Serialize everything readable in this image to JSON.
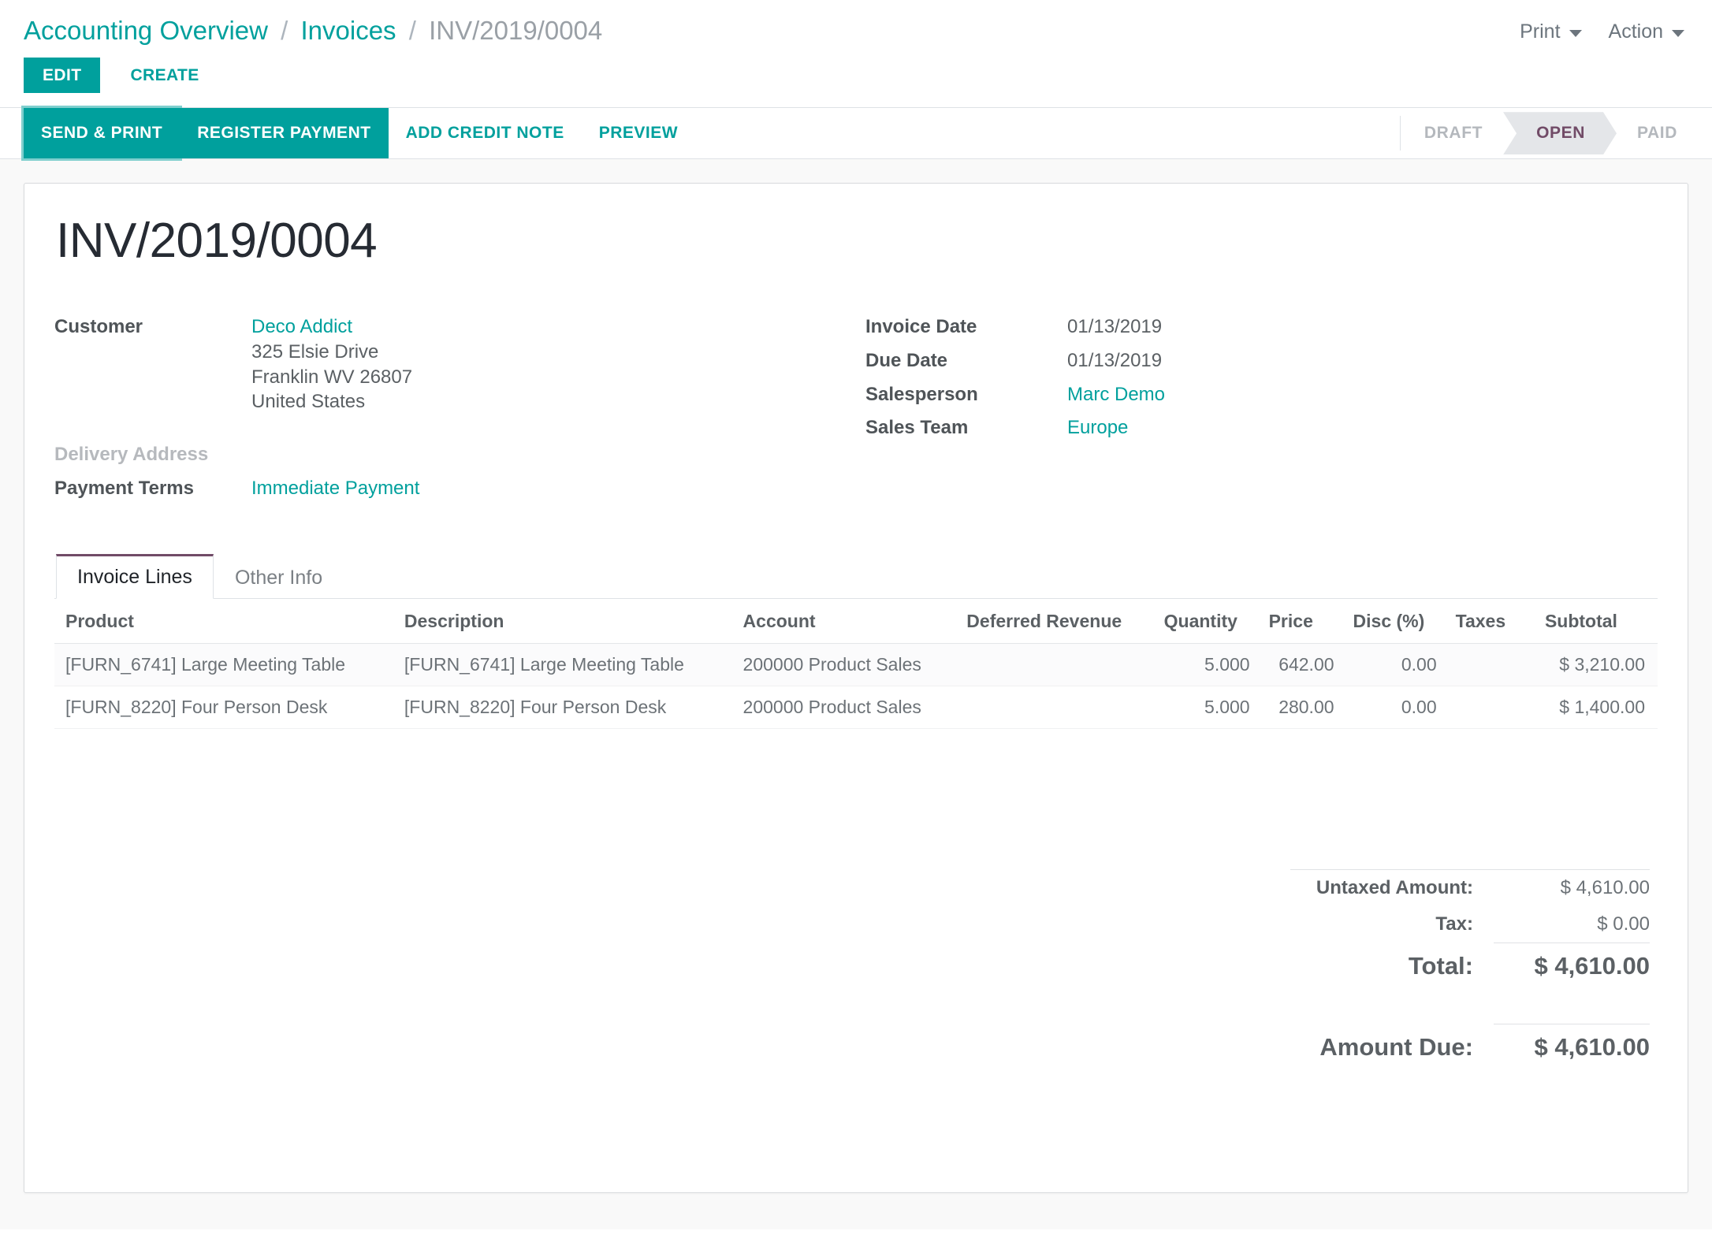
{
  "breadcrumb": {
    "root": "Accounting Overview",
    "sep": "/",
    "parent": "Invoices",
    "current": "INV/2019/0004"
  },
  "control_panel": {
    "edit_label": "EDIT",
    "create_label": "CREATE",
    "print_label": "Print",
    "action_label": "Action"
  },
  "statusbar": {
    "buttons": [
      {
        "label": "SEND & PRINT",
        "style": "primary",
        "focused": true
      },
      {
        "label": "REGISTER PAYMENT",
        "style": "primary",
        "focused": false
      },
      {
        "label": "ADD CREDIT NOTE",
        "style": "link",
        "focused": false
      },
      {
        "label": "PREVIEW",
        "style": "link",
        "focused": false
      }
    ],
    "stages": [
      {
        "label": "DRAFT",
        "active": false
      },
      {
        "label": "OPEN",
        "active": true
      },
      {
        "label": "PAID",
        "active": false
      }
    ]
  },
  "document": {
    "title": "INV/2019/0004",
    "left_fields": {
      "customer_label": "Customer",
      "customer_name": "Deco Addict",
      "address_line1": "325 Elsie Drive",
      "address_line2": "Franklin WV 26807",
      "address_line3": "United States",
      "delivery_address_label": "Delivery Address",
      "delivery_address_value": "",
      "payment_terms_label": "Payment Terms",
      "payment_terms_value": "Immediate Payment"
    },
    "right_fields": {
      "invoice_date_label": "Invoice Date",
      "invoice_date_value": "01/13/2019",
      "due_date_label": "Due Date",
      "due_date_value": "01/13/2019",
      "salesperson_label": "Salesperson",
      "salesperson_value": "Marc Demo",
      "sales_team_label": "Sales Team",
      "sales_team_value": "Europe"
    }
  },
  "notebook": {
    "tabs": [
      {
        "label": "Invoice Lines",
        "active": true
      },
      {
        "label": "Other Info",
        "active": false
      }
    ]
  },
  "lines_table": {
    "headers": {
      "product": "Product",
      "description": "Description",
      "account": "Account",
      "deferred_revenue": "Deferred Revenue",
      "quantity": "Quantity",
      "price": "Price",
      "disc": "Disc (%)",
      "taxes": "Taxes",
      "subtotal": "Subtotal"
    },
    "rows": [
      {
        "product": "[FURN_6741] Large Meeting Table",
        "description": "[FURN_6741] Large Meeting Table",
        "account": "200000 Product Sales",
        "deferred_revenue": "",
        "quantity": "5.000",
        "price": "642.00",
        "disc": "0.00",
        "taxes": "",
        "subtotal": "$ 3,210.00"
      },
      {
        "product": "[FURN_8220] Four Person Desk",
        "description": "[FURN_8220] Four Person Desk",
        "account": "200000 Product Sales",
        "deferred_revenue": "",
        "quantity": "5.000",
        "price": "280.00",
        "disc": "0.00",
        "taxes": "",
        "subtotal": "$ 1,400.00"
      }
    ]
  },
  "totals": {
    "untaxed_label": "Untaxed Amount:",
    "untaxed_value": "$ 4,610.00",
    "tax_label": "Tax:",
    "tax_value": "$ 0.00",
    "total_label": "Total:",
    "total_value": "$ 4,610.00",
    "amount_due_label": "Amount Due:",
    "amount_due_value": "$ 4,610.00"
  },
  "colors": {
    "accent_teal": "#00a09d",
    "brand_purple": "#714b67",
    "text_muted": "#6c757d",
    "stage_bg": "#e4e6e9"
  }
}
